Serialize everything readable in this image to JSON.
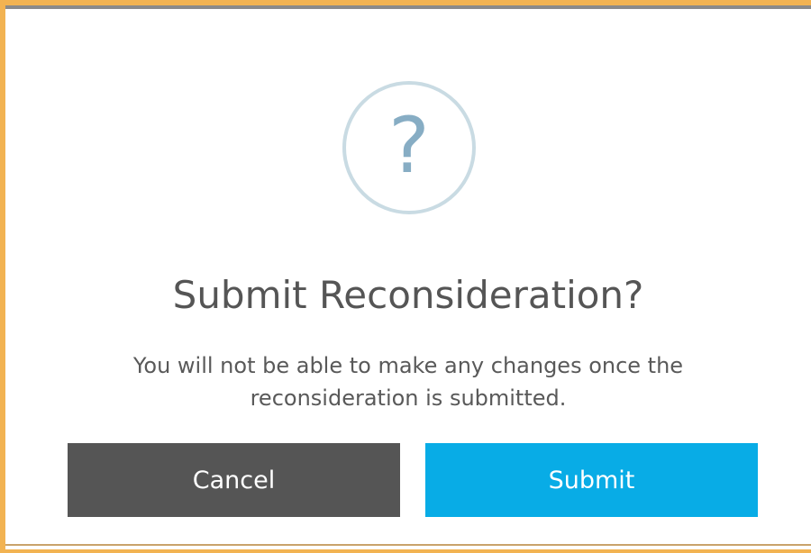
{
  "dialog": {
    "icon": {
      "name": "question-mark-icon",
      "glyph": "?"
    },
    "title": "Submit Reconsideration?",
    "message_line1": "You will not be able to make any changes once the",
    "message_line2": "reconsideration is submitted.",
    "buttons": {
      "cancel_label": "Cancel",
      "submit_label": "Submit"
    }
  },
  "colors": {
    "frame": "#f2b352",
    "title": "#555555",
    "message": "#595959",
    "icon_ring": "#c9dbe3",
    "icon_glyph": "#87adc4",
    "cancel_bg": "#555555",
    "submit_bg": "#08ace6"
  }
}
